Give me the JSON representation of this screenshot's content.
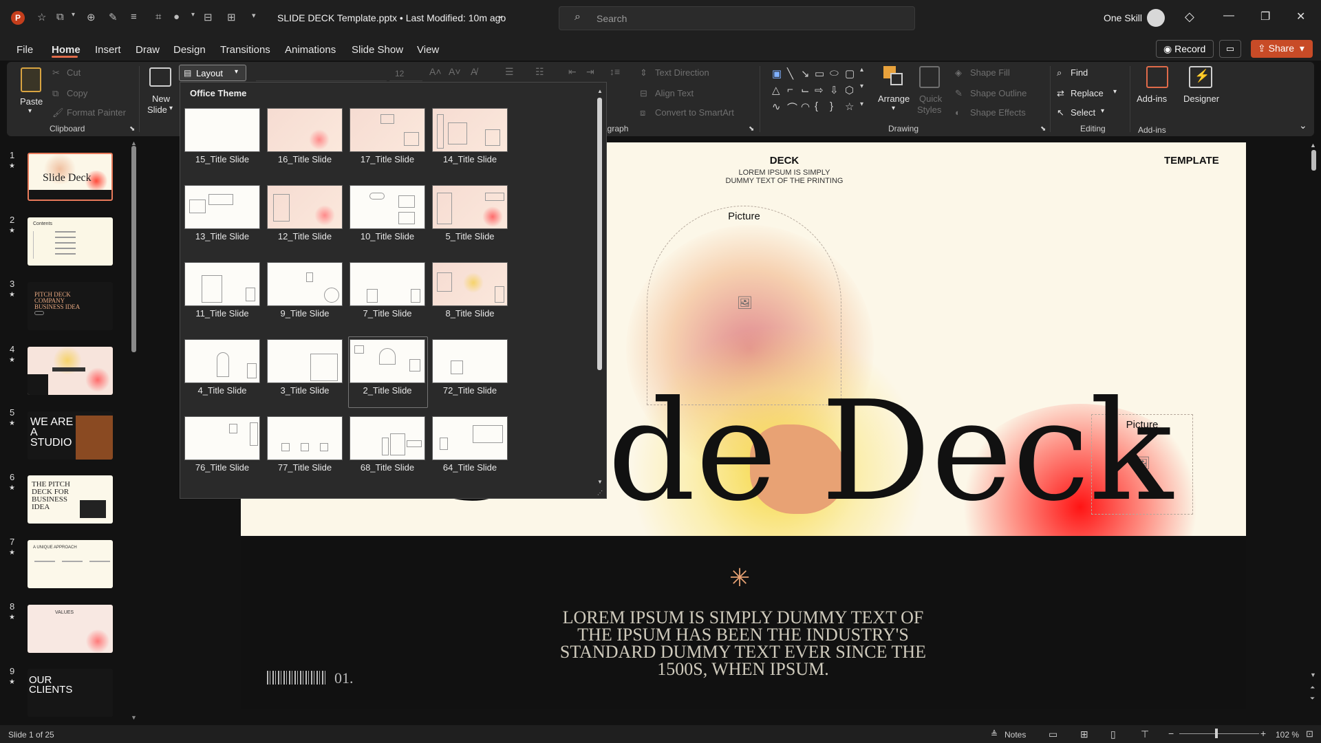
{
  "titlebar": {
    "doc_title": "SLIDE DECK Template.pptx • Last Modified: 10m ago",
    "search_placeholder": "Search",
    "user_name": "One Skill",
    "app_icon": "P"
  },
  "menu": {
    "tabs": [
      "File",
      "Home",
      "Insert",
      "Draw",
      "Design",
      "Transitions",
      "Animations",
      "Slide Show",
      "View"
    ],
    "record": "Record",
    "share": "Share"
  },
  "ribbon": {
    "paste": "Paste",
    "cut": "Cut",
    "copy": "Copy",
    "format_painter": "Format Painter",
    "clipboard": "Clipboard",
    "new_slide": [
      "New",
      "Slide"
    ],
    "layout": "Layout",
    "font_size": "12",
    "text_direction": "Text Direction",
    "align_text": "Align Text",
    "convert_smartart": "Convert to SmartArt",
    "paragraph": "agraph",
    "arrange": "Arrange",
    "quick_styles": [
      "Quick",
      "Styles"
    ],
    "shape_fill": "Shape Fill",
    "shape_outline": "Shape Outline",
    "shape_effects": "Shape Effects",
    "drawing": "Drawing",
    "find": "Find",
    "replace": "Replace",
    "select": "Select",
    "editing": "Editing",
    "addins": "Add-ins",
    "addins_group": "Add-ins",
    "designer": "Designer"
  },
  "thumbnails": {
    "numbers": [
      "1",
      "2",
      "3",
      "4",
      "5",
      "6",
      "7",
      "8",
      "9"
    ],
    "t1": "Slide Deck",
    "t2": "Contents",
    "t3": "PITCH DECK COMPANY BUSINESS IDEA",
    "t5": "WE ARE A STUDIO",
    "t6": "THE PITCH DECK FOR BUSINESS IDEA",
    "t7": "A UNIQUE APPROACH",
    "t8": "VALUES",
    "t9": "OUR CLIENTS"
  },
  "layout_panel": {
    "heading": "Office Theme",
    "items": [
      "15_Title Slide",
      "16_Title Slide",
      "17_Title Slide",
      "14_Title Slide",
      "13_Title Slide",
      "12_Title Slide",
      "10_Title Slide",
      "5_Title Slide",
      "11_Title Slide",
      "9_Title Slide",
      "7_Title Slide",
      "8_Title Slide",
      "4_Title Slide",
      "3_Title Slide",
      "2_Title Slide",
      "72_Title Slide",
      "76_Title Slide",
      "77_Title Slide",
      "68_Title Slide",
      "64_Title Slide"
    ]
  },
  "slide": {
    "deck": "DECK",
    "deck_sub": [
      "LOREM IPSUM IS SIMPLY",
      "DUMMY TEXT OF THE PRINTING"
    ],
    "template": "TEMPLATE",
    "picture1": "Picture",
    "picture2": "Picture",
    "big_title": "Slide Deck",
    "body_lines": [
      "LOREM IPSUM IS SIMPLY DUMMY TEXT OF",
      "THE IPSUM HAS BEEN THE INDUSTRY'S",
      "STANDARD DUMMY TEXT EVER SINCE THE",
      "1500S, WHEN IPSUM."
    ],
    "page_num": "01."
  },
  "status": {
    "slide_count": "Slide 1 of 25",
    "notes": "Notes",
    "zoom": "102 %"
  }
}
